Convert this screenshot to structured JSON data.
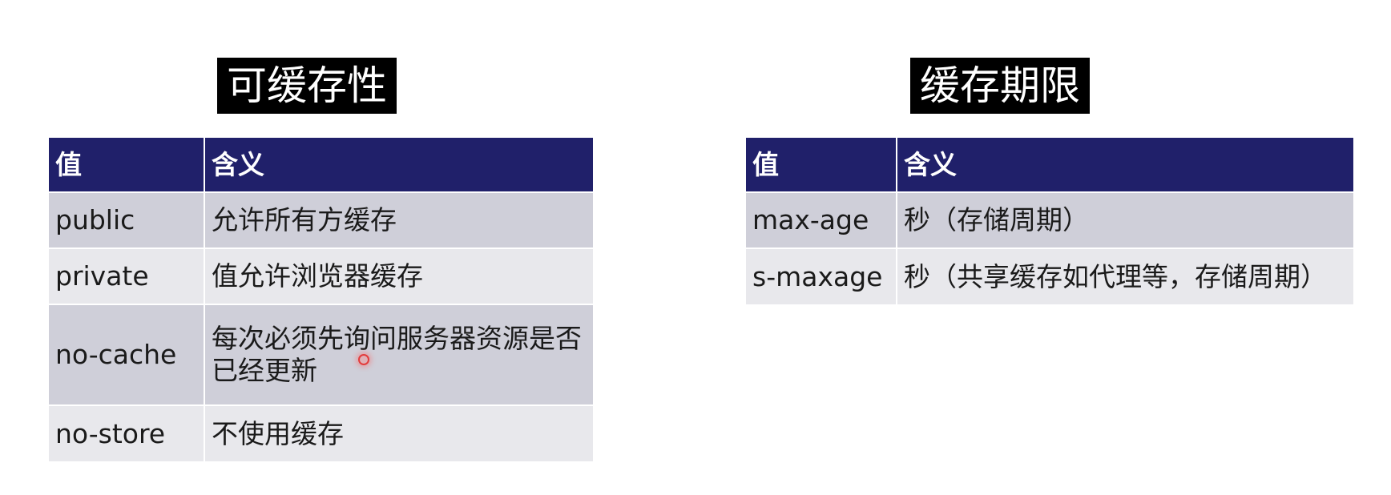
{
  "left": {
    "title": "可缓存性",
    "headers": [
      "值",
      "含义"
    ],
    "rows": [
      {
        "value": "public",
        "meaning": "允许所有方缓存"
      },
      {
        "value": "private",
        "meaning": "值允许浏览器缓存"
      },
      {
        "value": "no-cache",
        "meaning": "每次必须先询问服务器资源是否已经更新"
      },
      {
        "value": "no-store",
        "meaning": "不使用缓存"
      }
    ]
  },
  "right": {
    "title": "缓存期限",
    "headers": [
      "值",
      "含义"
    ],
    "rows": [
      {
        "value": "max-age",
        "meaning": "秒（存储周期）"
      },
      {
        "value": "s-maxage",
        "meaning": "秒（共享缓存如代理等，存储周期）"
      }
    ]
  },
  "colors": {
    "header_bg": "#20206a",
    "row_dark": "#cfcfd9",
    "row_light": "#e8e8ec",
    "title_bg": "#000000",
    "pointer": "#e33b3b"
  }
}
